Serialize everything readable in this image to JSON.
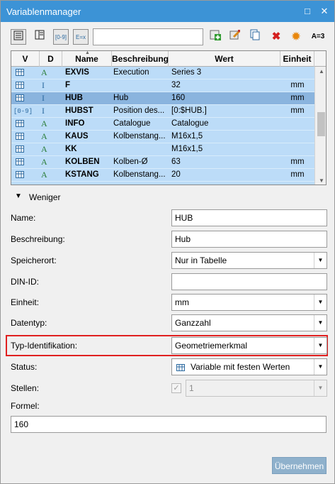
{
  "window": {
    "title": "Variablenmanager"
  },
  "titlebar": {
    "restore_glyph": "□",
    "close_glyph": "✕"
  },
  "toolbar": {
    "icons": [
      "list-view-icon",
      "detail-view-icon",
      "range-variable-icon",
      "expression-variable-icon",
      "add-variable-icon",
      "edit-variable-icon",
      "copy-variable-icon",
      "delete-variable-icon",
      "settings-icon",
      "rename-variable-icon"
    ],
    "range_label": "[0-9]",
    "expr_label": "E=x",
    "rename_label": "A=3",
    "search_value": ""
  },
  "table": {
    "columns": [
      "V",
      "D",
      "Name",
      "Beschreibung",
      "Wert",
      "Einheit"
    ],
    "rows": [
      {
        "v_icon": "table-icon",
        "d_icon": "text-icon",
        "name": "EXVIS",
        "description": "Execution",
        "value": "Series 3",
        "unit": "",
        "selected": false
      },
      {
        "v_icon": "table-icon",
        "d_icon": "integer-icon",
        "name": "F",
        "description": "",
        "value": "32",
        "unit": "mm",
        "selected": false
      },
      {
        "v_icon": "table-icon",
        "d_icon": "integer-icon",
        "name": "HUB",
        "description": "Hub",
        "value": "160",
        "unit": "mm",
        "selected": true
      },
      {
        "v_icon": "range-icon",
        "d_icon": "integer-icon",
        "name": "HUBST",
        "description": "Position des...",
        "value": "[0:$HUB.]",
        "unit": "mm",
        "selected": false
      },
      {
        "v_icon": "table-icon",
        "d_icon": "text-icon",
        "name": "INFO",
        "description": "Catalogue",
        "value": "Catalogue",
        "unit": "",
        "selected": false
      },
      {
        "v_icon": "table-icon",
        "d_icon": "text-icon",
        "name": "KAUS",
        "description": "Kolbenstang...",
        "value": "M16x1,5",
        "unit": "",
        "selected": false
      },
      {
        "v_icon": "table-icon",
        "d_icon": "text-icon",
        "name": "KK",
        "description": "",
        "value": "M16x1,5",
        "unit": "",
        "selected": false
      },
      {
        "v_icon": "table-icon",
        "d_icon": "text-icon",
        "name": "KOLBEN",
        "description": "Kolben-Ø",
        "value": "63",
        "unit": "mm",
        "selected": false
      },
      {
        "v_icon": "table-icon",
        "d_icon": "text-icon",
        "name": "KSTANG",
        "description": "Kolbenstang...",
        "value": "20",
        "unit": "mm",
        "selected": false
      }
    ],
    "glyph_a": "A",
    "glyph_i": "I",
    "glyph_range": "[0-9]"
  },
  "details": {
    "collapse_label": "Weniger",
    "fields": {
      "name": {
        "label": "Name:",
        "value": "HUB"
      },
      "description": {
        "label": "Beschreibung:",
        "value": "Hub"
      },
      "storage": {
        "label": "Speicherort:",
        "value": "Nur in Tabelle"
      },
      "din_id": {
        "label": "DIN-ID:",
        "value": ""
      },
      "unit": {
        "label": "Einheit:",
        "value": "mm"
      },
      "datatype": {
        "label": "Datentyp:",
        "value": "Ganzzahl"
      },
      "type_id": {
        "label": "Typ-Identifikation:",
        "value": "Geometriemerkmal"
      },
      "status": {
        "label": "Status:",
        "value": "Variable mit festen Werten"
      },
      "digits": {
        "label": "Stellen:",
        "value": "1",
        "checked": true
      },
      "formula": {
        "label": "Formel:",
        "value": "160"
      }
    },
    "apply_label": "Übernehmen"
  },
  "colors": {
    "titlebar": "#3c93d6",
    "row": "#bcdcf8",
    "row_selected": "#8ab4de",
    "highlight": "#e02020"
  }
}
